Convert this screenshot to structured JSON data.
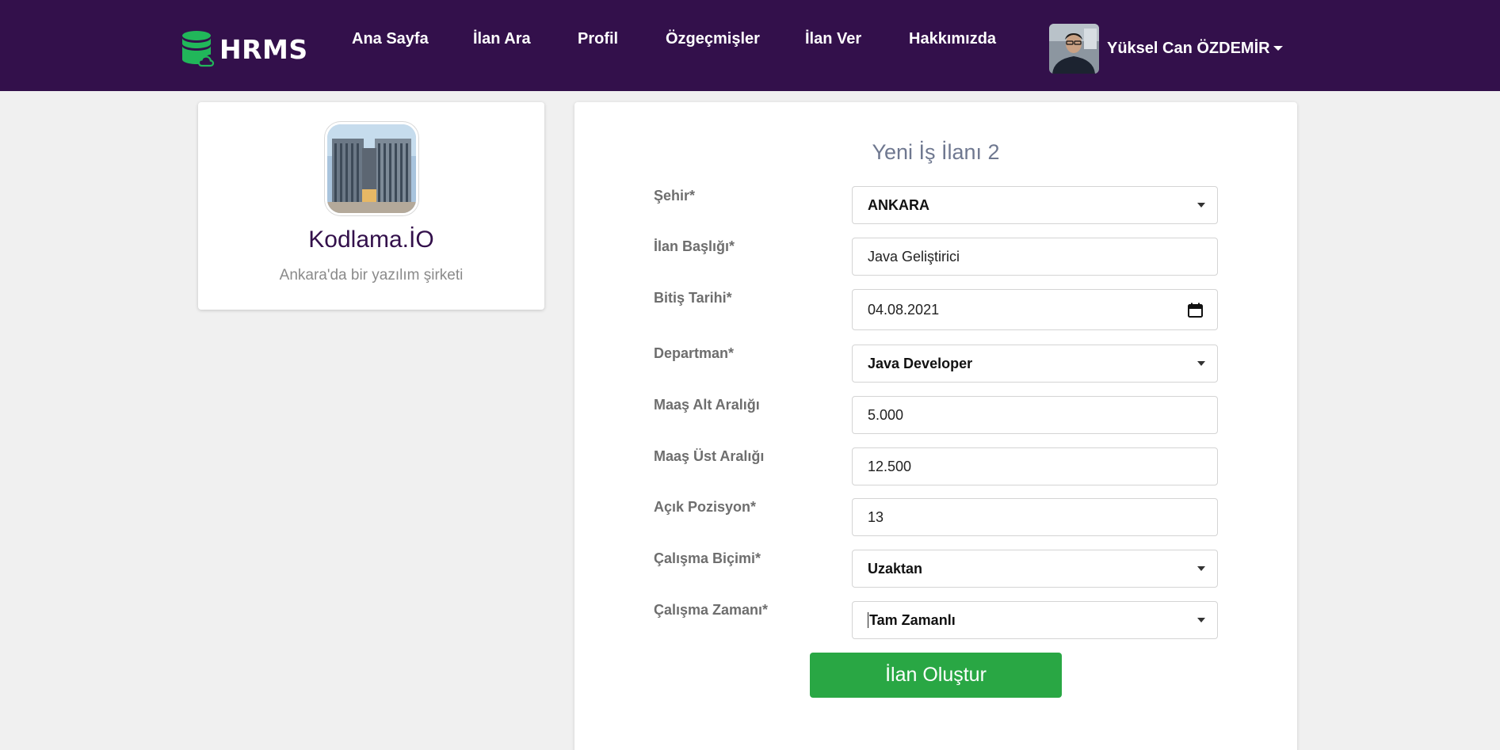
{
  "nav": {
    "brand": "HRMS",
    "links": [
      "Ana Sayfa",
      "İlan Ara",
      "Profil",
      "Özgeçmişler",
      "İlan Ver",
      "Hakkımızda"
    ],
    "user_name": "Yüksel Can ÖZDEMİR"
  },
  "company": {
    "name": "Kodlama.İO",
    "description": "Ankara'da bir yazılım şirketi"
  },
  "form": {
    "title": "Yeni İş İlanı 2",
    "fields": [
      {
        "label": "Şehir*",
        "value": "ANKARA",
        "kind": "select"
      },
      {
        "label": "İlan Başlığı*",
        "value": "Java Geliştirici",
        "kind": "input"
      },
      {
        "label": "Bitiş Tarihi*",
        "value": "04.08.2021",
        "kind": "date"
      },
      {
        "label": "Departman*",
        "value": "Java Developer",
        "kind": "select"
      },
      {
        "label": "Maaş Alt Aralığı",
        "value": "5.000",
        "kind": "input"
      },
      {
        "label": "Maaş Üst Aralığı",
        "value": "12.500",
        "kind": "input"
      },
      {
        "label": "Açık Pozisyon*",
        "value": "13",
        "kind": "input"
      },
      {
        "label": "Çalışma Biçimi*",
        "value": "Uzaktan",
        "kind": "select"
      },
      {
        "label": "Çalışma Zamanı*",
        "value": "Tam Zamanlı",
        "kind": "select"
      }
    ],
    "submit_label": "İlan Oluştur"
  },
  "colors": {
    "navbar": "#33104b",
    "accent": "#33104b",
    "submit": "#29a744",
    "logo_green": "#21b75a"
  },
  "icons": [
    "database-cloud-logo-icon",
    "chevron-down-icon",
    "calendar-icon"
  ]
}
